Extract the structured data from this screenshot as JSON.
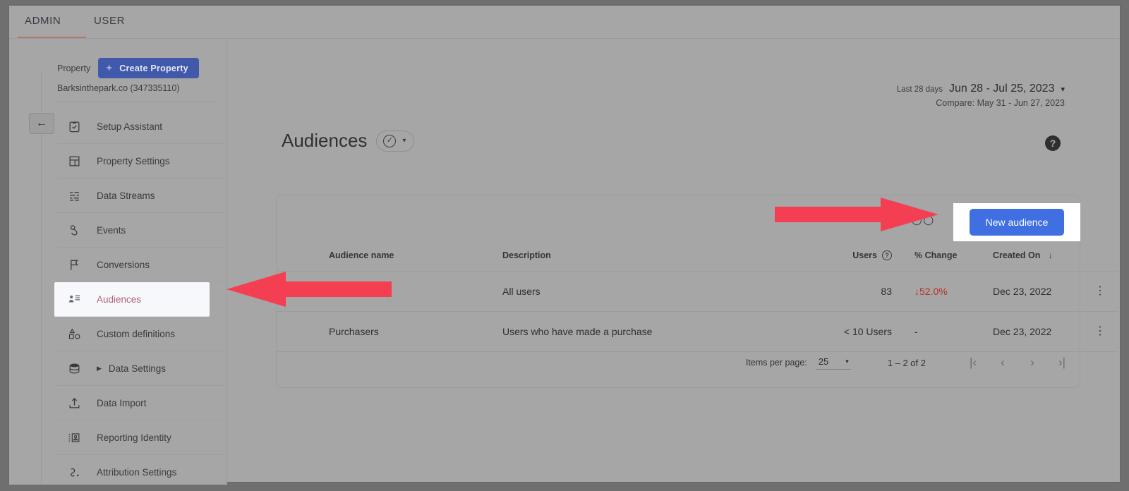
{
  "topnav": {
    "tabs": [
      {
        "label": "ADMIN",
        "active": true
      },
      {
        "label": "USER",
        "active": false
      }
    ]
  },
  "sidebar": {
    "property_label": "Property",
    "create_property_button": "Create Property",
    "create_property_icon": "plus-icon",
    "property_name": "Barksinthepark.co (347335110)",
    "back_icon": "arrow-left-icon",
    "items": [
      {
        "label": "Setup Assistant",
        "icon": "clipboard-check-icon",
        "selected": false
      },
      {
        "label": "Property Settings",
        "icon": "layout-panel-icon",
        "selected": false
      },
      {
        "label": "Data Streams",
        "icon": "data-streams-icon",
        "selected": false
      },
      {
        "label": "Events",
        "icon": "tap-hand-icon",
        "selected": false
      },
      {
        "label": "Conversions",
        "icon": "flag-icon",
        "selected": false
      },
      {
        "label": "Audiences",
        "icon": "audience-person-list-icon",
        "selected": true
      },
      {
        "label": "Custom definitions",
        "icon": "shapes-icon",
        "selected": false
      },
      {
        "label": "Data Settings",
        "icon": "database-icon",
        "selected": false,
        "expandable": true
      },
      {
        "label": "Data Import",
        "icon": "upload-icon",
        "selected": false
      },
      {
        "label": "Reporting Identity",
        "icon": "id-card-icon",
        "selected": false
      },
      {
        "label": "Attribution Settings",
        "icon": "attribution-path-icon",
        "selected": false
      }
    ]
  },
  "header": {
    "date_prefix": "Last 28 days",
    "date_range": "Jun 28 - Jul 25, 2023",
    "date_caret_icon": "chevron-down-icon",
    "compare_text": "Compare: May 31 - Jun 27, 2023",
    "page_title": "Audiences",
    "title_chip_icon": "check-circle-icon",
    "title_chip_caret_icon": "chevron-down-icon",
    "help_icon": "help-question-icon"
  },
  "card": {
    "obscured_text": "◯◯",
    "new_audience_button": "New audience",
    "table": {
      "columns": [
        {
          "key": "name",
          "label": "Audience name"
        },
        {
          "key": "desc",
          "label": "Description"
        },
        {
          "key": "users",
          "label": "Users",
          "info_icon": "help-question-icon"
        },
        {
          "key": "change",
          "label": "% Change"
        },
        {
          "key": "date",
          "label": "Created On",
          "sort_icon": "arrow-down-icon",
          "sorted": true
        },
        {
          "key": "menu",
          "label": ""
        }
      ],
      "rows": [
        {
          "name": "",
          "desc": "All users",
          "users": "83",
          "change": "52.0%",
          "change_direction": "down",
          "change_arrow_icon": "arrow-down-icon",
          "date": "Dec 23, 2022",
          "menu_icon": "more-vert-icon"
        },
        {
          "name": "Purchasers",
          "desc": "Users who have made a purchase",
          "users": "< 10 Users",
          "change": "-",
          "change_direction": "none",
          "date": "Dec 23, 2022",
          "menu_icon": "more-vert-icon"
        }
      ]
    },
    "pagination": {
      "items_per_page_label": "Items per page:",
      "items_per_page_value": "25",
      "items_per_page_caret_icon": "chevron-down-icon",
      "range_text": "1 – 2 of 2",
      "first_page_icon": "first-page-icon",
      "prev_page_icon": "chevron-left-icon",
      "next_page_icon": "chevron-right-icon",
      "last_page_icon": "last-page-icon"
    }
  },
  "annotations": {
    "arrow_color": "#f43f53",
    "arrows": [
      {
        "name": "arrow-pointing-to-new-audience-button",
        "direction": "right"
      },
      {
        "name": "arrow-pointing-to-audiences-sidebar-item",
        "direction": "left"
      }
    ]
  },
  "colors": {
    "accent_blue": "#3f6fe0",
    "create_property_blue": "#4059ab",
    "negative_red": "#b13024",
    "annotation_red": "#f43f53",
    "tab_underline": "#b5705f"
  }
}
